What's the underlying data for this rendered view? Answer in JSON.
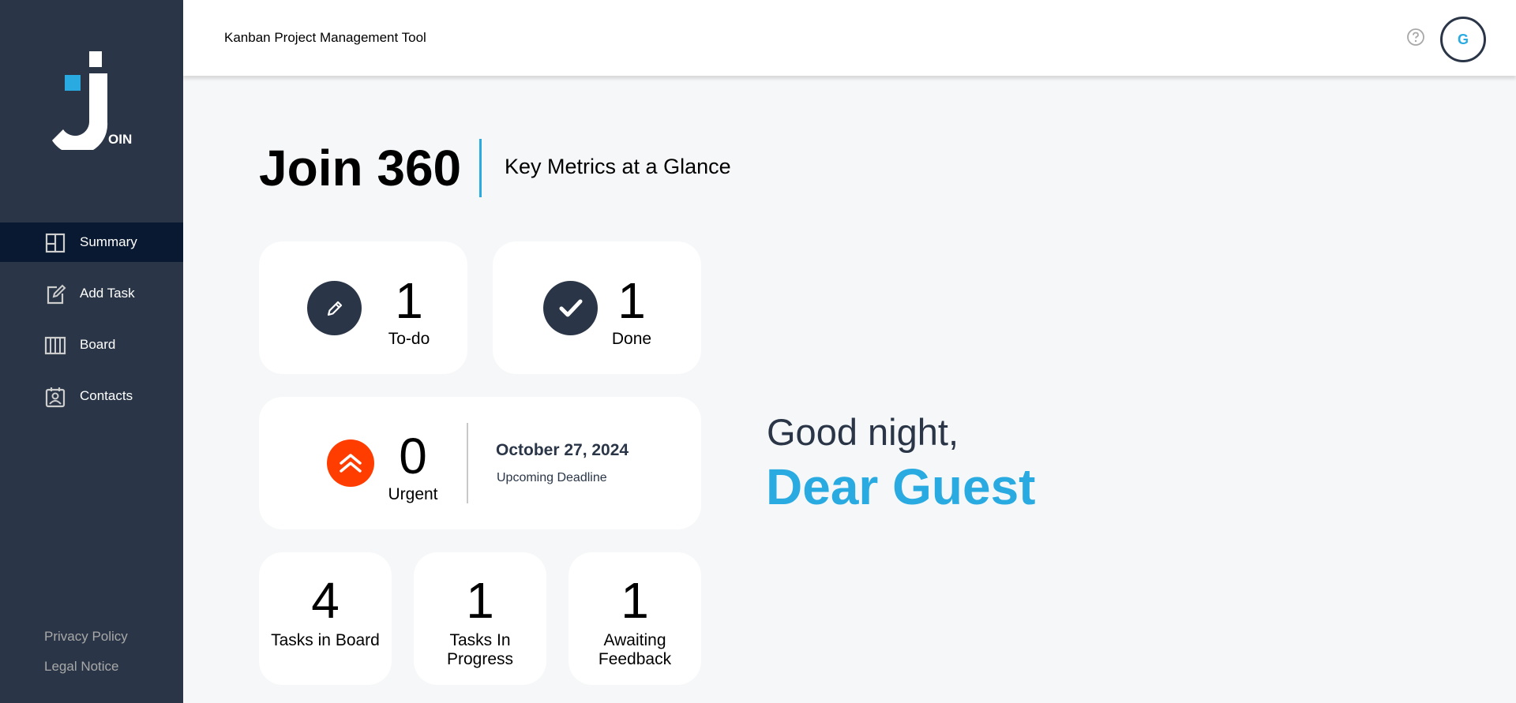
{
  "app": {
    "header_title": "Kanban Project Management Tool",
    "logo_text": "OIN",
    "avatar_initial": "G"
  },
  "sidebar": {
    "items": [
      {
        "label": "Summary",
        "icon": "summary-icon",
        "active": true
      },
      {
        "label": "Add Task",
        "icon": "edit-icon",
        "active": false
      },
      {
        "label": "Board",
        "icon": "board-icon",
        "active": false
      },
      {
        "label": "Contacts",
        "icon": "contacts-icon",
        "active": false
      }
    ],
    "footer": [
      "Privacy Policy",
      "Legal Notice"
    ]
  },
  "main": {
    "title": "Join 360",
    "subtitle": "Key Metrics at a Glance",
    "todo": {
      "count": "1",
      "label": "To-do"
    },
    "done": {
      "count": "1",
      "label": "Done"
    },
    "urgent": {
      "count": "0",
      "label": "Urgent",
      "deadline_date": "October 27, 2024",
      "deadline_label": "Upcoming Deadline"
    },
    "stats": [
      {
        "count": "4",
        "label": "Tasks in Board"
      },
      {
        "count": "1",
        "label": "Tasks In Progress"
      },
      {
        "count": "1",
        "label": "Awaiting Feedback"
      }
    ],
    "greeting": "Good night,",
    "user_name": "Dear Guest"
  },
  "colors": {
    "sidebar_bg": "#2a3647",
    "active_bg": "#091931",
    "accent": "#29abe2",
    "urgent": "#ff3d00",
    "page_bg": "#f6f7f8"
  }
}
